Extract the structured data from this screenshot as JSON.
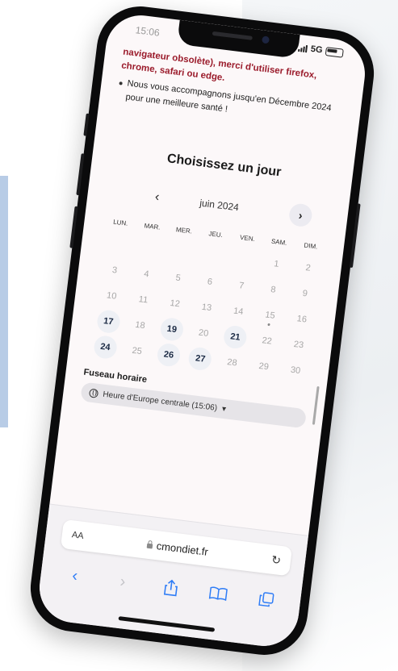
{
  "status": {
    "time": "15:06",
    "network": "5G"
  },
  "notice": {
    "warning_text": "navigateur obsolète), merci d'utiliser firefox, chrome, safari ou edge.",
    "bullet_text": "Nous vous accompagnons jusqu'en Décembre 2024 pour une meilleure santé !"
  },
  "calendar": {
    "title": "Choisissez un jour",
    "month_label": "juin 2024",
    "prev_icon": "chevron-left-icon",
    "next_icon": "chevron-right-icon",
    "weekdays": [
      "LUN.",
      "MAR.",
      "MER.",
      "JEU.",
      "VEN.",
      "SAM.",
      "DIM."
    ],
    "weeks": [
      [
        {
          "d": ""
        },
        {
          "d": ""
        },
        {
          "d": ""
        },
        {
          "d": ""
        },
        {
          "d": ""
        },
        {
          "d": "1"
        },
        {
          "d": "2"
        }
      ],
      [
        {
          "d": "3"
        },
        {
          "d": "4"
        },
        {
          "d": "5"
        },
        {
          "d": "6"
        },
        {
          "d": "7"
        },
        {
          "d": "8"
        },
        {
          "d": "9"
        }
      ],
      [
        {
          "d": "10"
        },
        {
          "d": "11"
        },
        {
          "d": "12"
        },
        {
          "d": "13"
        },
        {
          "d": "14"
        },
        {
          "d": "15",
          "today": true
        },
        {
          "d": "16"
        }
      ],
      [
        {
          "d": "17",
          "available": true
        },
        {
          "d": "18"
        },
        {
          "d": "19",
          "available": true
        },
        {
          "d": "20"
        },
        {
          "d": "21",
          "available": true
        },
        {
          "d": "22"
        },
        {
          "d": "23"
        }
      ],
      [
        {
          "d": "24",
          "available": true
        },
        {
          "d": "25"
        },
        {
          "d": "26",
          "available": true
        },
        {
          "d": "27",
          "available": true
        },
        {
          "d": "28"
        },
        {
          "d": "29"
        },
        {
          "d": "30"
        }
      ]
    ]
  },
  "timezone": {
    "label": "Fuseau horaire",
    "value": "Heure d'Europe centrale (15:06)",
    "icon": "globe-icon"
  },
  "browser": {
    "text_size_label": "AA",
    "url": "cmondiet.fr",
    "reload_icon": "reload-icon",
    "toolbar_icons": [
      "back-icon",
      "forward-icon",
      "share-icon",
      "bookmarks-icon",
      "tabs-icon"
    ]
  },
  "colors": {
    "accent": "#2f7df6",
    "warning": "#9b1c2c",
    "available_day": "#eef0f5"
  }
}
